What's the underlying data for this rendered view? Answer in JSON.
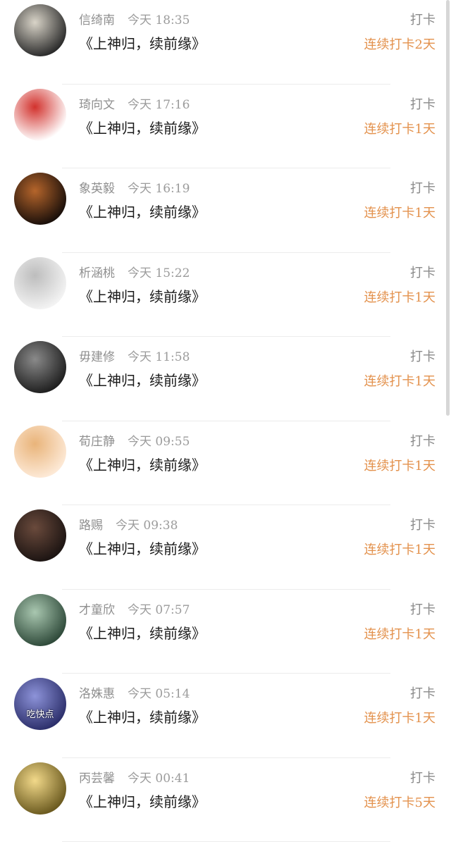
{
  "entries": [
    {
      "name": "信绮南",
      "time": "今天 18:35",
      "title": "《上神归，续前缘》",
      "tag": "打卡",
      "streak": "连续打卡2天",
      "avatar": {
        "colors": [
          "#2b2b2b",
          "#d9d4c8"
        ],
        "text": ""
      }
    },
    {
      "name": "琦向文",
      "time": "今天 17:16",
      "title": "《上神归，续前缘》",
      "tag": "打卡",
      "streak": "连续打卡1天",
      "avatar": {
        "colors": [
          "#ffffff",
          "#d2322d"
        ],
        "text": ""
      }
    },
    {
      "name": "象英毅",
      "time": "今天 16:19",
      "title": "《上神归，续前缘》",
      "tag": "打卡",
      "streak": "连续打卡1天",
      "avatar": {
        "colors": [
          "#1a0f0a",
          "#b5652b"
        ],
        "text": ""
      }
    },
    {
      "name": "析涵桃",
      "time": "今天 15:22",
      "title": "《上神归，续前缘》",
      "tag": "打卡",
      "streak": "连续打卡1天",
      "avatar": {
        "colors": [
          "#f3f3f3",
          "#bdbdbd"
        ],
        "text": ""
      }
    },
    {
      "name": "毋建修",
      "time": "今天 11:58",
      "title": "《上神归，续前缘》",
      "tag": "打卡",
      "streak": "连续打卡1天",
      "avatar": {
        "colors": [
          "#1f1f1f",
          "#8a8a8a"
        ],
        "text": ""
      }
    },
    {
      "name": "荀庄静",
      "time": "今天 09:55",
      "title": "《上神归，续前缘》",
      "tag": "打卡",
      "streak": "连续打卡1天",
      "avatar": {
        "colors": [
          "#fde9d6",
          "#e9b47a"
        ],
        "text": ""
      }
    },
    {
      "name": "路赐",
      "time": "今天 09:38",
      "title": "《上神归，续前缘》",
      "tag": "打卡",
      "streak": "连续打卡1天",
      "avatar": {
        "colors": [
          "#1c1412",
          "#6a4a3c"
        ],
        "text": ""
      }
    },
    {
      "name": "才童欣",
      "time": "今天 07:57",
      "title": "《上神归，续前缘》",
      "tag": "打卡",
      "streak": "连续打卡1天",
      "avatar": {
        "colors": [
          "#2f4a3a",
          "#a9c7b0"
        ],
        "text": ""
      }
    },
    {
      "name": "洛姝惠",
      "time": "今天 05:14",
      "title": "《上神归，续前缘》",
      "tag": "打卡",
      "streak": "连续打卡1天",
      "avatar": {
        "colors": [
          "#2c2f6b",
          "#8d93d9"
        ],
        "text": "吃快点"
      }
    },
    {
      "name": "丙芸馨",
      "time": "今天 00:41",
      "title": "《上神归，续前缘》",
      "tag": "打卡",
      "streak": "连续打卡5天",
      "avatar": {
        "colors": [
          "#6b5a1f",
          "#f2d98a"
        ],
        "text": ""
      }
    }
  ]
}
